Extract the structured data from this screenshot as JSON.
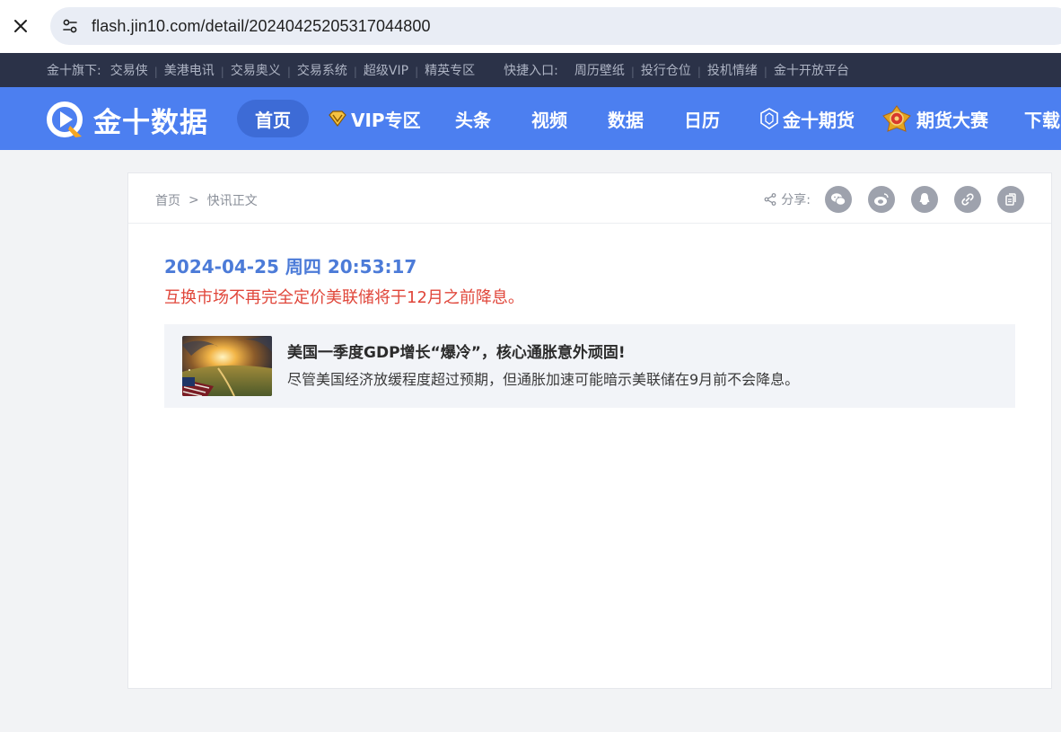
{
  "browser": {
    "url": "flash.jin10.com/detail/20240425205317044800"
  },
  "topstrip": {
    "group_label": "金十旗下:",
    "group_links": [
      "交易侠",
      "美港电讯",
      "交易奥义",
      "交易系统",
      "超级VIP",
      "精英专区"
    ],
    "quick_label": "快捷入口:",
    "quick_links": [
      "周历壁纸",
      "投行仓位",
      "投机情绪",
      "金十开放平台"
    ]
  },
  "nav": {
    "logo_text": "金十数据",
    "items": [
      "首页",
      "VIP专区",
      "头条",
      "视频",
      "数据",
      "日历",
      "金十期货",
      "期货大赛",
      "下载"
    ],
    "active_index": 0
  },
  "breadcrumb": {
    "home": "首页",
    "separator": ">",
    "current": "快讯正文"
  },
  "share": {
    "label": "分享:",
    "icons": [
      "wechat-icon",
      "weibo-icon",
      "qq-icon",
      "link-icon",
      "copy-icon"
    ]
  },
  "flash": {
    "time": "2024-04-25 周四 20:53:17",
    "text": "互换市场不再完全定价美联储将于12月之前降息。"
  },
  "related": {
    "title": "美国一季度GDP增长“爆冷”，核心通胀意外顽固!",
    "desc": "尽管美国经济放缓程度超过预期，但通胀加速可能暗示美联储在9月前不会降息。"
  },
  "colors": {
    "nav_bg": "#4c7ff0",
    "topstrip_bg": "#2b3248",
    "time_blue": "#4c7bd8",
    "flash_red": "#e0463a"
  }
}
